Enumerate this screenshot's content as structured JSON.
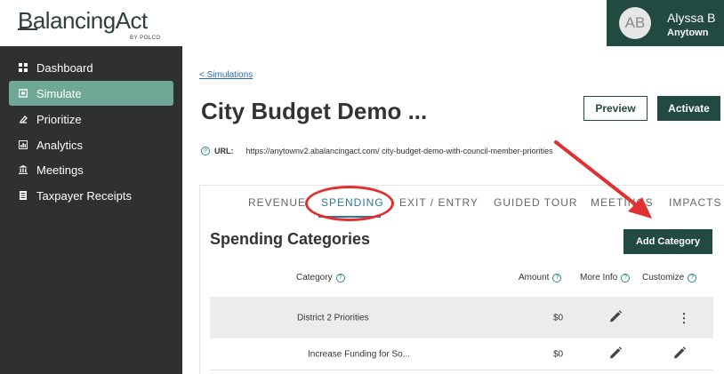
{
  "brand": {
    "logo": "BalancingAct",
    "sub": "BY POLCO"
  },
  "user": {
    "initials": "AB",
    "name": "Alyssa B",
    "org": "Anytown"
  },
  "sidebar": {
    "items": [
      {
        "label": "Dashboard",
        "icon": "dashboard-icon"
      },
      {
        "label": "Simulate",
        "icon": "simulate-icon"
      },
      {
        "label": "Prioritize",
        "icon": "prioritize-icon"
      },
      {
        "label": "Analytics",
        "icon": "analytics-icon"
      },
      {
        "label": "Meetings",
        "icon": "meetings-icon"
      },
      {
        "label": "Taxpayer Receipts",
        "icon": "receipt-icon"
      }
    ],
    "active_index": 1,
    "active_color": "#6fa897"
  },
  "main": {
    "back_link": "< Simulations",
    "title": "City Budget Demo ...",
    "preview_label": "Preview",
    "activate_label": "Activate",
    "url_label": "URL:",
    "url_value": "https://anytownv2.abalancingact.com/ city-budget-demo-with-council-member-priorities"
  },
  "tabs": [
    {
      "label": "REVENUE"
    },
    {
      "label": "SPENDING"
    },
    {
      "label": "EXIT / ENTRY"
    },
    {
      "label": "GUIDED TOUR"
    },
    {
      "label": "MEETINGS"
    },
    {
      "label": "IMPACTS"
    }
  ],
  "active_tab": "SPENDING",
  "section": {
    "title": "Spending Categories",
    "add_label": "Add Category"
  },
  "table": {
    "headers": {
      "category": "Category",
      "amount": "Amount",
      "more_info": "More Info",
      "customize": "Customize"
    },
    "rows": [
      {
        "category": "District 2 Priorities",
        "amount": "$0",
        "more_info": "pencil-icon",
        "customize": "kebab-menu-icon"
      },
      {
        "category": "Increase Funding for So...",
        "amount": "$0",
        "more_info": "pencil-icon",
        "customize": "pencil-icon"
      }
    ]
  },
  "colors": {
    "brand_dark": "#224a40",
    "sidebar_bg": "#2e312f",
    "accent_blue": "#2b7a9a",
    "annotation_red": "#e03030"
  }
}
